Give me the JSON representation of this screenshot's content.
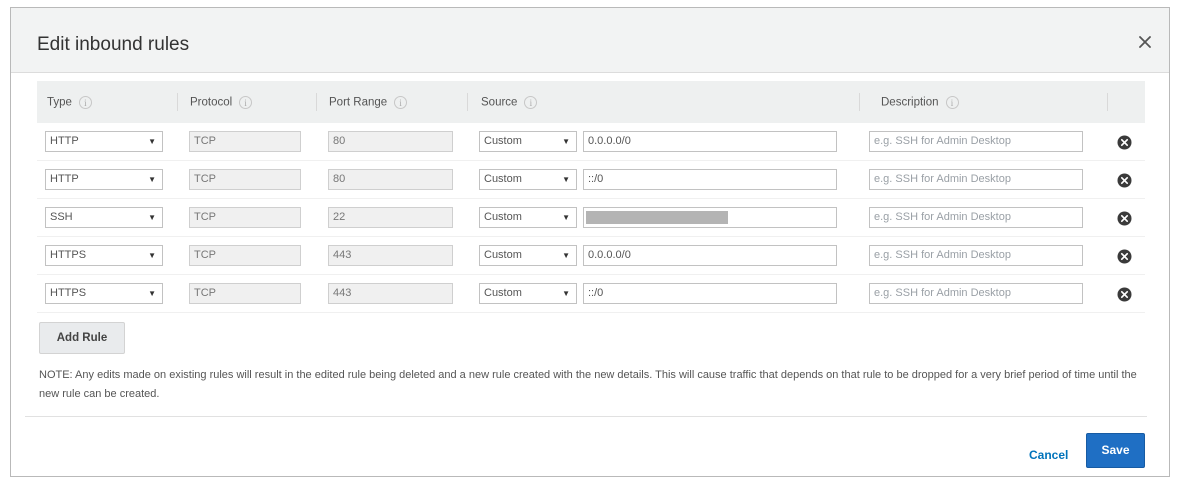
{
  "dialog": {
    "title": "Edit inbound rules"
  },
  "table": {
    "headers": {
      "type": "Type",
      "protocol": "Protocol",
      "port_range": "Port Range",
      "source": "Source",
      "description": "Description"
    },
    "info_glyph": "i",
    "rows": [
      {
        "type": "HTTP",
        "protocol": "TCP",
        "port": "80",
        "source_type": "Custom",
        "source": "0.0.0.0/0",
        "description_placeholder": "e.g. SSH for Admin Desktop"
      },
      {
        "type": "HTTP",
        "protocol": "TCP",
        "port": "80",
        "source_type": "Custom",
        "source": "::/0",
        "description_placeholder": "e.g. SSH for Admin Desktop"
      },
      {
        "type": "SSH",
        "protocol": "TCP",
        "port": "22",
        "source_type": "Custom",
        "source": "",
        "source_masked": true,
        "description_placeholder": "e.g. SSH for Admin Desktop"
      },
      {
        "type": "HTTPS",
        "protocol": "TCP",
        "port": "443",
        "source_type": "Custom",
        "source": "0.0.0.0/0",
        "description_placeholder": "e.g. SSH for Admin Desktop"
      },
      {
        "type": "HTTPS",
        "protocol": "TCP",
        "port": "443",
        "source_type": "Custom",
        "source": "::/0",
        "description_placeholder": "e.g. SSH for Admin Desktop"
      }
    ]
  },
  "add_rule_label": "Add Rule",
  "note": "NOTE: Any edits made on existing rules will result in the edited rule being deleted and a new rule created with the new details. This will cause traffic that depends on that rule to be dropped for a very brief period of time until the new rule can be created.",
  "footer": {
    "cancel_label": "Cancel",
    "save_label": "Save"
  },
  "icons": {
    "close": "close-icon",
    "delete": "remove-circle-icon",
    "caret": "caret-down-icon"
  },
  "colors": {
    "primary": "#1f6fc4",
    "link": "#0073bb",
    "header_bg": "#f2f3f3"
  }
}
